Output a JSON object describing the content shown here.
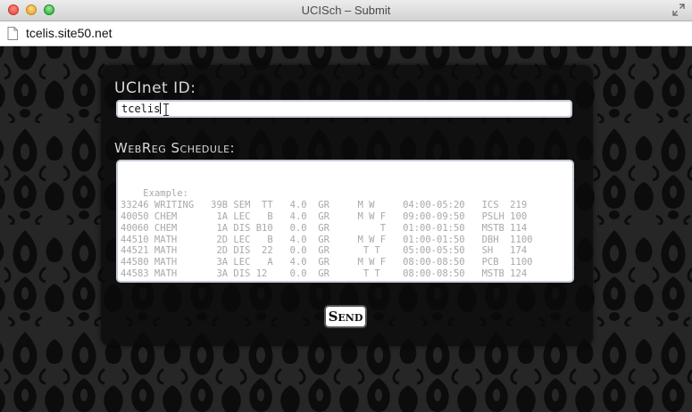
{
  "window": {
    "title": "UCISch – Submit",
    "url": "tcelis.site50.net"
  },
  "form": {
    "id_label": "UCInet ID:",
    "id_value": "tcelis",
    "schedule_label": "WebReg Schedule:",
    "schedule_placeholder": "Example:\n33246 WRITING   39B SEM  TT   4.0  GR     M W     04:00-05:20   ICS  219\n40050 CHEM       1A LEC   B   4.0  GR     M W F   09:00-09:50   PSLH 100\n40060 CHEM       1A DIS B10   0.0  GR         T   01:00-01:50   MSTB 114\n44510 MATH       2D LEC   B   4.0  GR     M W F   01:00-01:50   DBH  1100\n44521 MATH       2D DIS  22   0.0  GR      T T    05:00-05:50   SH   174\n44580 MATH       3A LEC   A   4.0  GR     M W F   08:00-08:50   PCB  1100\n44583 MATH       3A DIS 12    0.0  GR      T T    08:00-08:50   MSTB 124",
    "send_label": "Send"
  },
  "icons": {
    "close": "close-window-icon",
    "minimize": "minimize-window-icon",
    "zoom": "zoom-window-icon",
    "fullscreen": "fullscreen-icon",
    "page": "page-icon",
    "cursor": "text-cursor-icon"
  },
  "colors": {
    "page_background": "#232323",
    "panel_background": "#0a0a0a",
    "label_text": "#d8d8d8",
    "input_border": "#c4cbd6",
    "placeholder_text": "#a8a8a8"
  }
}
